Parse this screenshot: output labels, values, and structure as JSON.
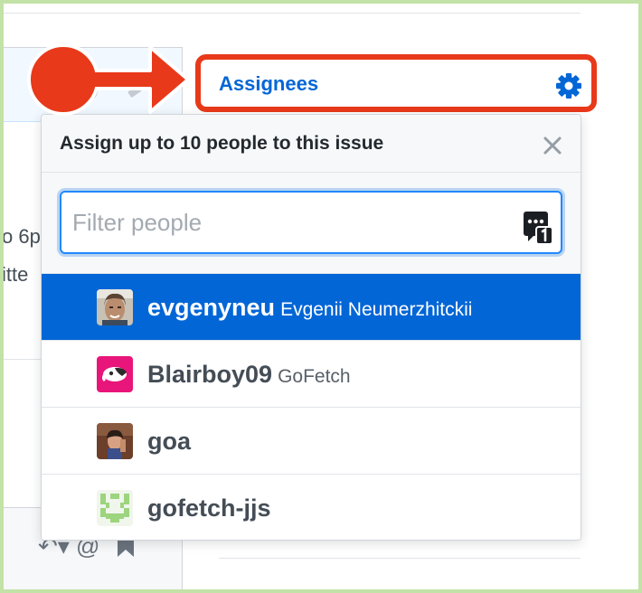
{
  "sidebar": {
    "assignees_label": "Assignees"
  },
  "background": {
    "text_line_1": "o 6p",
    "text_line_2": "itte",
    "comment_icons": "↶▾ @"
  },
  "dropdown": {
    "title": "Assign up to 10 people to this issue",
    "filter": {
      "placeholder": "Filter people",
      "value": ""
    },
    "users": [
      {
        "login": "evgenyneu",
        "name": "Evgenii Neumerzhitckii",
        "selected": true
      },
      {
        "login": "Blairboy09",
        "name": "GoFetch",
        "selected": false
      },
      {
        "login": "goa",
        "name": "",
        "selected": false
      },
      {
        "login": "gofetch-jjs",
        "name": "",
        "selected": false
      }
    ]
  },
  "colors": {
    "annotation": "#e8391a",
    "accent": "#0366d6",
    "frame": "#c3e2a7"
  },
  "icons": {
    "settings": "gear-icon",
    "close": "close-icon",
    "filter_badge": "counter-icon"
  }
}
